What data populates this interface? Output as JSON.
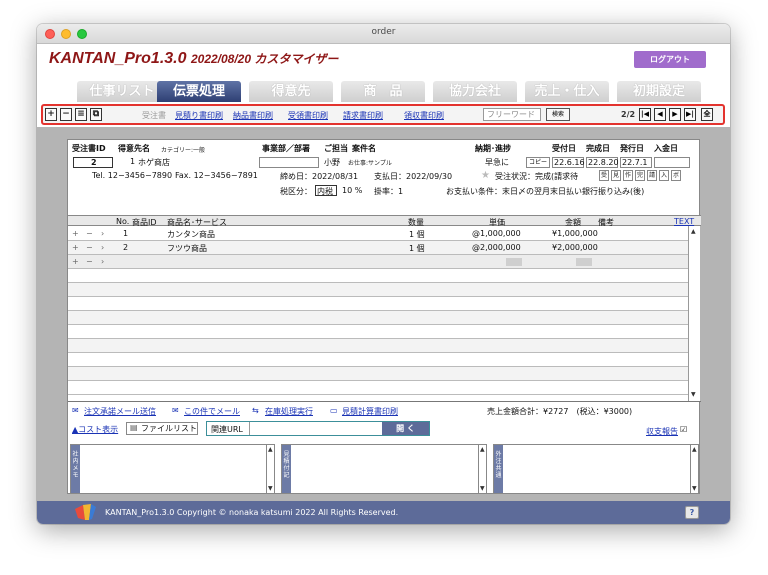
{
  "window": {
    "title": "order"
  },
  "app": {
    "title": "KANTAN_Pro1.3.0",
    "subtitle": "2022/08/20 カスタマイザー",
    "logout_label": "ログアウト"
  },
  "tabs": [
    {
      "label": "仕事リスト",
      "active": false
    },
    {
      "label": "伝票処理",
      "active": true
    },
    {
      "label": "得意先",
      "active": false
    },
    {
      "label": "商　品",
      "active": false
    },
    {
      "label": "協力会社",
      "active": false
    },
    {
      "label": "売上・仕入",
      "active": false
    },
    {
      "label": "初期設定",
      "active": false
    }
  ],
  "toolbar": {
    "btn_add": "+",
    "btn_remove": "−",
    "btn_list": "≡",
    "btn_copy": "⧉",
    "label_order": "受注書",
    "links": [
      "見積り書印刷",
      "納品書印刷",
      "受領書印刷",
      "請求書印刷",
      "領収書印刷"
    ],
    "search_placeholder": "フリーワード",
    "search_button": "検索",
    "page": "2/2",
    "nav_first": "|◀",
    "nav_prev": "◀",
    "nav_next": "▶",
    "nav_last": "▶|",
    "nav_all": "全"
  },
  "order": {
    "headers": {
      "order_id": "受注書ID",
      "customer": "得意先名",
      "category": "カテゴリー:一般",
      "dept": "事業部／部署",
      "person": "ご担当",
      "case_name": "案件名",
      "delivery": "納期･進捗",
      "received": "受付日",
      "completed": "完成日",
      "issued": "発行日",
      "paid": "入金日"
    },
    "id": "2",
    "customer_no": "1",
    "customer_name": "ホゲ商店",
    "person": "小野",
    "case_label": "お仕事:サンプル",
    "progress": "早急に",
    "copy_label": "コピー",
    "received_date": "22.6.16",
    "completed_date": "22.8.20",
    "issued_date": "22.7.1",
    "tel": "Tel. 12−3456−7890",
    "fax": "Fax. 12−3456−7891",
    "closing_date": "締め日：2022/08/31",
    "payment_date": "支払日：2022/09/30",
    "status_label": "受注状況：完成(請求待",
    "status_buttons": [
      "受",
      "見",
      "作",
      "完",
      "請",
      "入",
      "ボ"
    ],
    "tax_label": "税区分：",
    "tax_type": "内税",
    "tax_rate": "10 %",
    "multiplier": "掛率：1",
    "payment_terms": "お支払い条件：末日〆の翌月末日払い銀行振り込み(後)"
  },
  "items": {
    "headers": {
      "no": "No.",
      "product_id": "商品ID",
      "name": "商品名･サービス",
      "qty": "数量",
      "unit_price": "単価",
      "amount": "金額",
      "note": "備考",
      "text": "TEXT"
    },
    "controls": {
      "add": "+",
      "remove": "−",
      "more": "›"
    },
    "rows": [
      {
        "no": "1",
        "name": "カンタン商品",
        "qty": "1 個",
        "unit_price": "@1,000,000",
        "amount": "¥1,000,000"
      },
      {
        "no": "2",
        "name": "フツウ商品",
        "qty": "1 個",
        "unit_price": "@2,000,000",
        "amount": "¥2,000,000"
      }
    ]
  },
  "bottom": {
    "links": [
      "注文承諾メール送信",
      "この件でメール",
      "在庫処理実行",
      "見積計算書印刷"
    ],
    "total_label": "売上金額合計：¥2727　(税込：¥3000)",
    "cost_link": "▲コスト表示",
    "file_list": "ファイルリスト",
    "related_url_label": "関連URL",
    "open_button": "開 く",
    "report_link": "収支報告",
    "memo_labels": [
      "社内メモ",
      "見積付記",
      "外注共通"
    ]
  },
  "footer": {
    "copyright": "KANTAN_Pro1.3.0  Copyright © nonaka katsumi 2022 All Rights Reserved.",
    "help": "?"
  }
}
